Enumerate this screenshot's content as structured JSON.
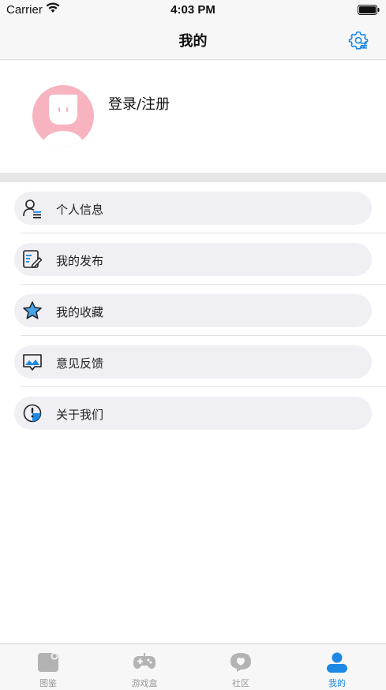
{
  "status_bar": {
    "carrier": "Carrier",
    "time": "4:03 PM"
  },
  "nav": {
    "title": "我的",
    "settings_icon": "settings-gear-icon"
  },
  "profile": {
    "login_label": "登录/注册",
    "avatar_icon": "avatar-icon"
  },
  "menu": [
    {
      "label": "个人信息",
      "icon": "person-info-icon"
    },
    {
      "label": "我的发布",
      "icon": "edit-note-icon"
    },
    {
      "label": "我的收藏",
      "icon": "star-icon"
    },
    {
      "label": "意见反馈",
      "icon": "feedback-icon"
    },
    {
      "label": "关于我们",
      "icon": "info-icon"
    }
  ],
  "tabs": [
    {
      "label": "图鉴",
      "icon": "catalog-icon"
    },
    {
      "label": "游戏盒",
      "icon": "gamepad-icon"
    },
    {
      "label": "社区",
      "icon": "chat-bubble-icon"
    },
    {
      "label": "我的",
      "icon": "user-icon",
      "active": true
    }
  ],
  "colors": {
    "accent": "#1e88e5",
    "avatar_bg": "#f7b3bf",
    "pill_bg": "#efeff4"
  }
}
